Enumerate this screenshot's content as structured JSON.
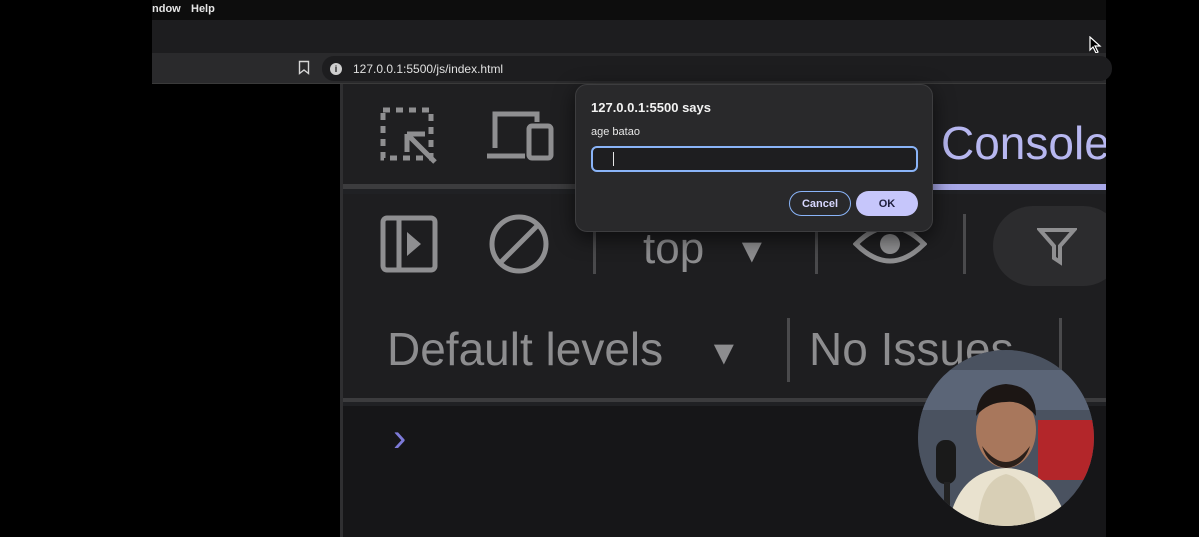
{
  "menubar": {
    "items": [
      "ndow",
      "Help"
    ]
  },
  "address_bar": {
    "url": "127.0.0.1:5500/js/index.html",
    "info_icon_glyph": "i"
  },
  "devtools": {
    "active_tab": "Console",
    "context_selector": "top",
    "log_levels": "Default levels",
    "issues": "No Issues",
    "prompt_glyph": "›",
    "dropdown_glyph": "▼"
  },
  "dialog": {
    "title": "127.0.0.1:5500 says",
    "message": "age batao",
    "input_value": "",
    "cancel_label": "Cancel",
    "ok_label": "OK"
  },
  "colors": {
    "accent": "#8ab4f8",
    "ok_button": "#c6c6fb",
    "console_tab": "#b7b7f0",
    "dialog_bg": "#29292b"
  },
  "icons": [
    "cursor-icon",
    "bookmark-icon",
    "info-icon",
    "inspect-element-icon",
    "device-toolbar-icon",
    "sidebar-toggle-icon",
    "clear-console-icon",
    "eye-icon",
    "filter-icon",
    "chevron-right-icon"
  ]
}
